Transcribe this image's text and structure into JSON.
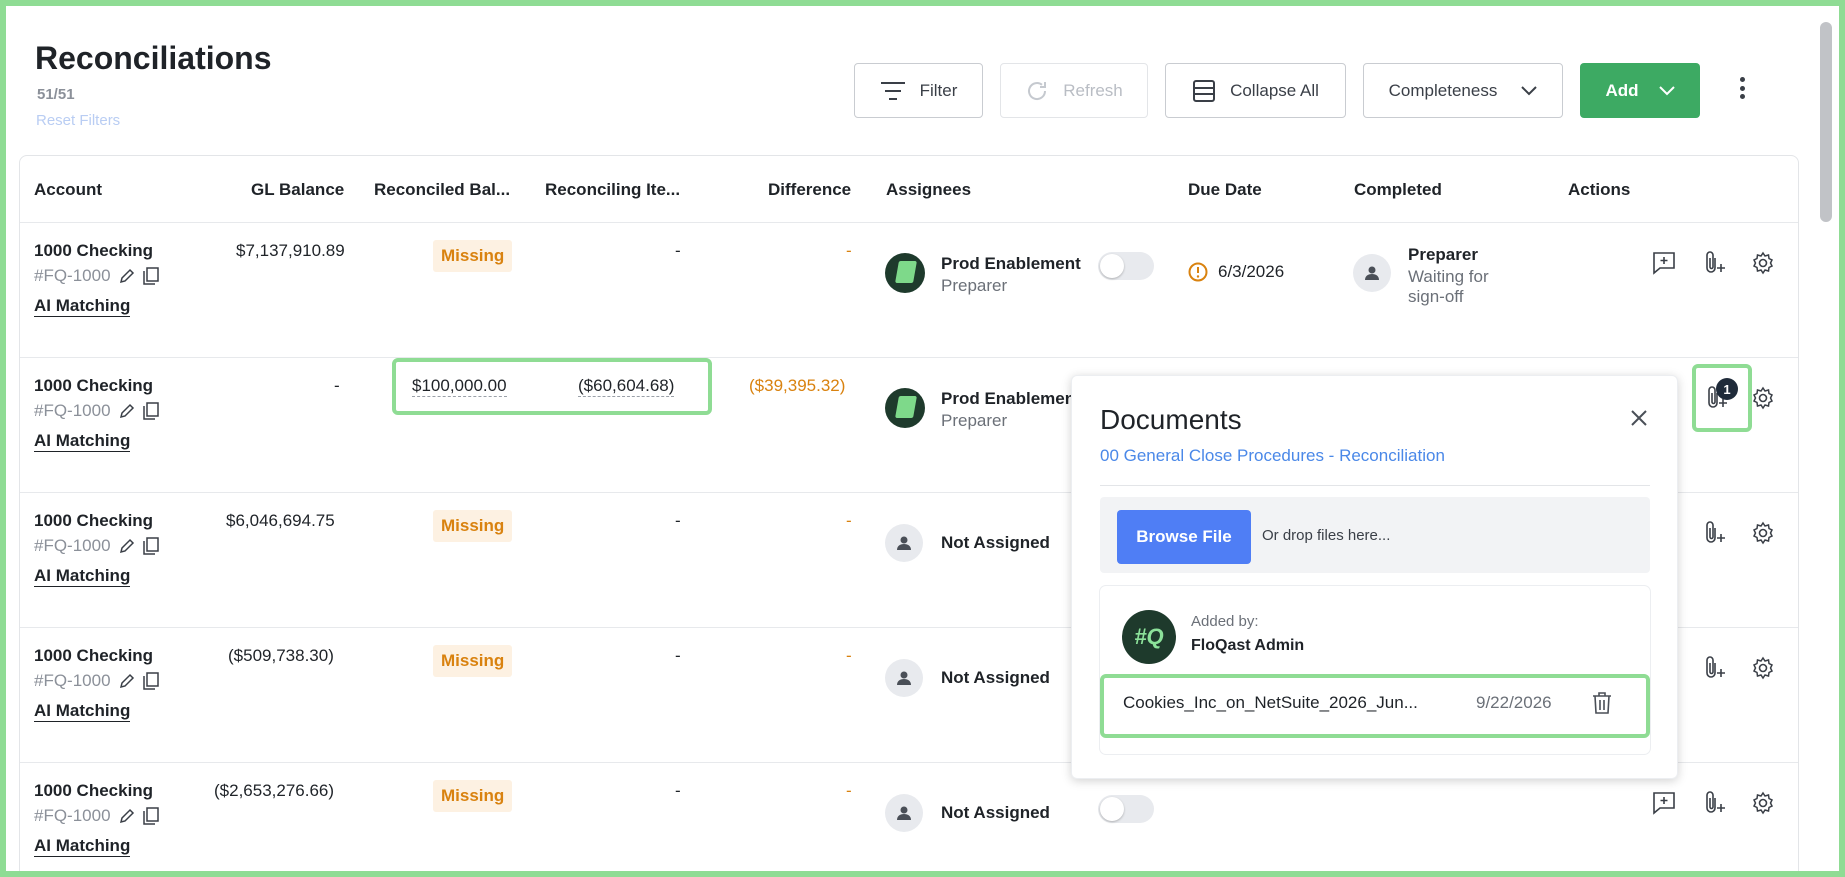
{
  "header": {
    "title": "Reconciliations",
    "count": "51/51",
    "reset_filters": "Reset Filters"
  },
  "toolbar": {
    "filter": "Filter",
    "refresh": "Refresh",
    "collapse_all": "Collapse All",
    "completeness": "Completeness",
    "add": "Add"
  },
  "columns": [
    "Account",
    "GL Balance",
    "Reconciled Bal...",
    "Reconciling Ite...",
    "Difference",
    "Assignees",
    "Due Date",
    "Completed",
    "Actions"
  ],
  "rows": [
    {
      "account": "1000 Checking",
      "account_id": "#FQ-1000",
      "link": "AI Matching",
      "gl_balance": "$7,137,910.89",
      "reconciled": "Missing",
      "reconciling": "-",
      "difference": "-",
      "assignee": "Prod Enablement",
      "role": "Preparer",
      "due_date": "6/3/2026",
      "completed_title": "Preparer",
      "completed_sub": "Waiting for sign-off"
    },
    {
      "account": "1000 Checking",
      "account_id": "#FQ-1000",
      "link": "AI Matching",
      "gl_balance": "-",
      "reconciled": "$100,000.00",
      "reconciling": "($60,604.68)",
      "difference": "($39,395.32)",
      "assignee": "Prod Enablemen",
      "role": "Preparer"
    },
    {
      "account": "1000 Checking",
      "account_id": "#FQ-1000",
      "link": "AI Matching",
      "gl_balance": "$6,046,694.75",
      "reconciled": "Missing",
      "reconciling": "-",
      "difference": "-",
      "assignee": "Not Assigned"
    },
    {
      "account": "1000 Checking",
      "account_id": "#FQ-1000",
      "link": "AI Matching",
      "gl_balance": "($509,738.30)",
      "reconciled": "Missing",
      "reconciling": "-",
      "difference": "-",
      "assignee": "Not Assigned"
    },
    {
      "account": "1000 Checking",
      "account_id": "#FQ-1000",
      "link": "AI Matching",
      "gl_balance": "($2,653,276.66)",
      "reconciled": "Missing",
      "reconciling": "-",
      "difference": "-",
      "assignee": "Not Assigned"
    }
  ],
  "documents_popover": {
    "title": "Documents",
    "subtitle": "00 General Close Procedures - Reconciliation",
    "browse_button": "Browse File",
    "drop_hint": "Or drop files here...",
    "logo_text": "#Q",
    "added_by_label": "Added by:",
    "added_by": "FloQast Admin",
    "file_name": "Cookies_Inc_on_NetSuite_2026_Jun...",
    "file_date": "9/22/2026"
  },
  "attachment_badge": "1",
  "colors": {
    "accent_green": "#3daa63",
    "link_blue": "#4a88e8",
    "warning_orange": "#d9820f",
    "highlight": "#8fdc94"
  }
}
